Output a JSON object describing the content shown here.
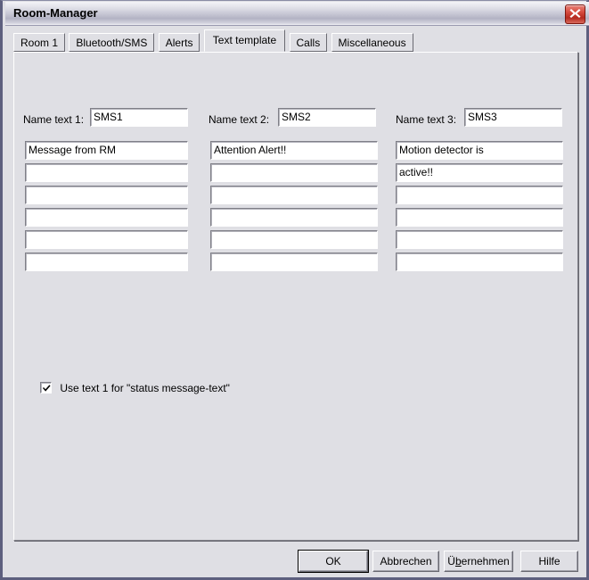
{
  "window": {
    "title": "Room-Manager",
    "close_icon": "close-x-icon"
  },
  "tabs": [
    {
      "label": "Room 1",
      "selected": false
    },
    {
      "label": "Bluetooth/SMS",
      "selected": false
    },
    {
      "label": "Alerts",
      "selected": false
    },
    {
      "label": "Text template",
      "selected": true
    },
    {
      "label": "Calls",
      "selected": false
    },
    {
      "label": "Miscellaneous",
      "selected": false
    }
  ],
  "columns": [
    {
      "name_label": "Name text 1:",
      "name_value": "SMS1",
      "lines": [
        "Message from RM",
        "",
        "",
        "",
        "",
        ""
      ]
    },
    {
      "name_label": "Name text 2:",
      "name_value": "SMS2",
      "lines": [
        "Attention Alert!!",
        "",
        "",
        "",
        "",
        ""
      ]
    },
    {
      "name_label": "Name text 3:",
      "name_value": "SMS3",
      "lines": [
        "Motion detector is",
        "active!!",
        "",
        "",
        "",
        ""
      ]
    }
  ],
  "checkbox": {
    "label": "Use text 1 for \"status message-text\"",
    "checked": true,
    "check_icon": "checkmark-icon"
  },
  "buttons": [
    {
      "label": "OK",
      "default": true
    },
    {
      "label": "Abbrechen",
      "default": false
    },
    {
      "label": "Übernehmen",
      "default": false,
      "mnemonic_index": 1
    },
    {
      "label": "Hilfe",
      "default": false
    }
  ],
  "colors": {
    "window_background": "#dfdfe4",
    "window_border": "#5d5f7e",
    "field_background": "#ffffff",
    "close_button": "#c1392b",
    "text": "#000000"
  }
}
